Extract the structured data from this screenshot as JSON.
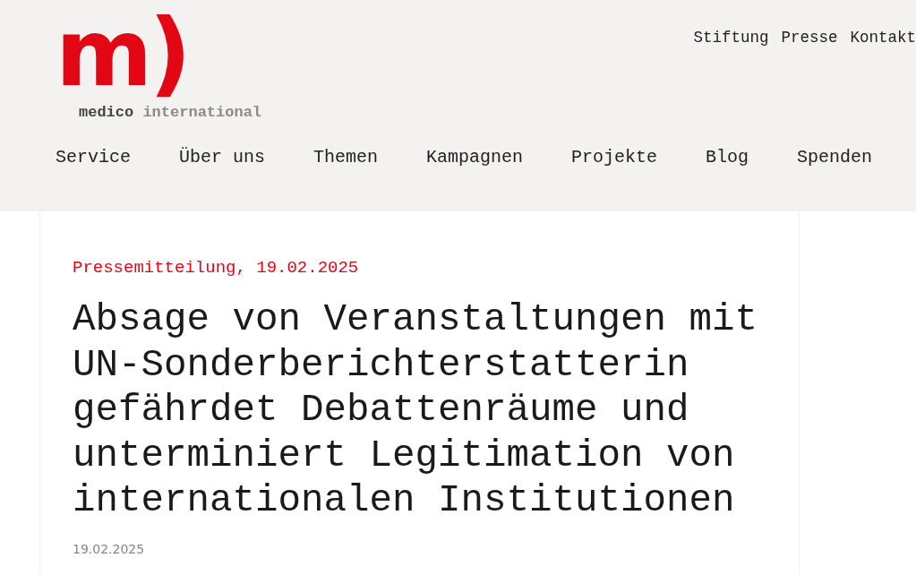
{
  "logo": {
    "mark": "m)",
    "name_bold": "medico",
    "name_light": "international"
  },
  "top_links": [
    "Stiftung",
    "Presse",
    "Kontakt"
  ],
  "nav": [
    "Service",
    "Über uns",
    "Themen",
    "Kampagnen",
    "Projekte",
    "Blog",
    "Spenden"
  ],
  "article": {
    "kicker": "Pressemitteilung, 19.02.2025",
    "title": "Absage von Veranstaltungen mit UN-Sonderberichterstatterin gefährdet Debattenräume und unterminiert Legitimation von internationalen Institutionen",
    "date": "19.02.2025"
  }
}
